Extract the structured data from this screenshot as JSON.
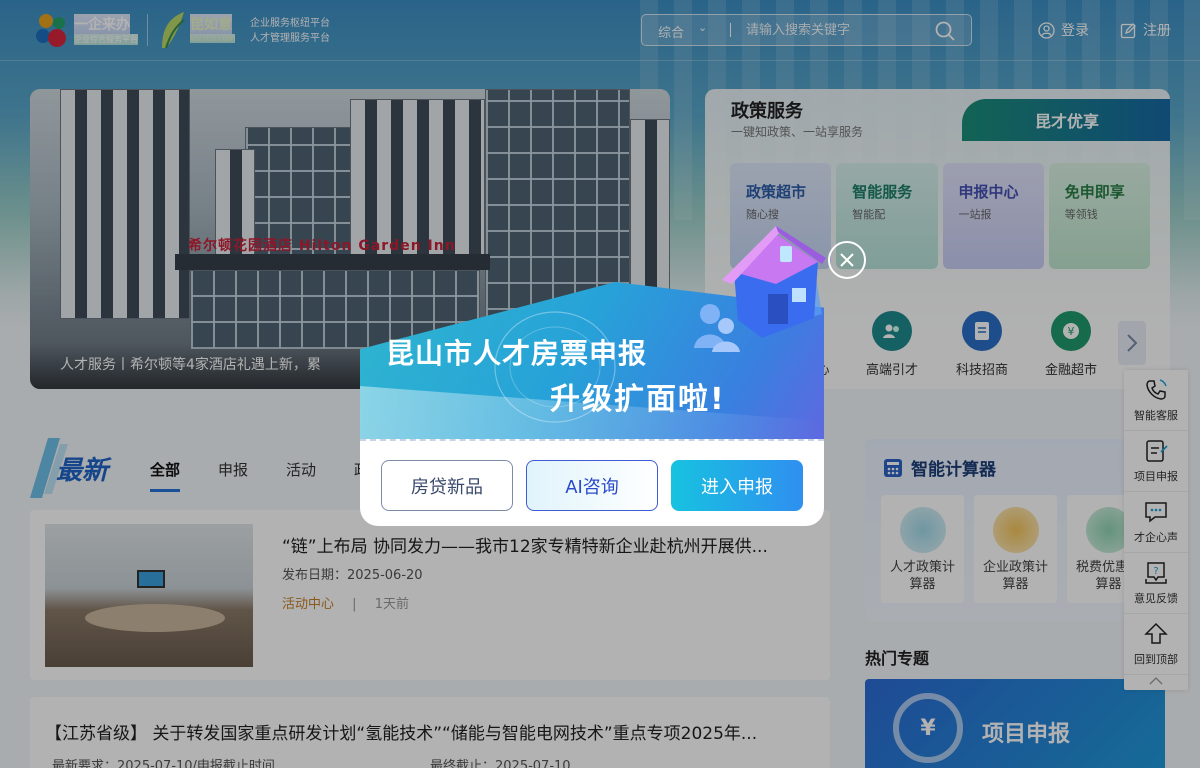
{
  "header": {
    "logo1_title": "一企来办",
    "logo1_sub": "企业综合服务平台",
    "logo2_title": "昆如意",
    "logo2_sub": "ksrstis.com",
    "platform_line1": "企业服务枢纽平台",
    "platform_line2": "人才管理服务平台",
    "search_scope": "综合",
    "search_placeholder": "请输入搜索关键字",
    "login": "登录",
    "register": "注册"
  },
  "banner": {
    "signage": "希尔顿花园酒店 Hilton Garden Inn",
    "caption": "人才服务丨希尔顿等4家酒店礼遇上新，累"
  },
  "policy": {
    "title": "政策服务",
    "subtitle": "一键知政策、一站享服务",
    "right_tab": "昆才优享",
    "tiles": [
      {
        "title": "政策超市",
        "sub": "随心搜"
      },
      {
        "title": "智能服务",
        "sub": "智能配"
      },
      {
        "title": "申报中心",
        "sub": "一站报"
      },
      {
        "title": "免申即享",
        "sub": "等领钱"
      }
    ],
    "quick": [
      {
        "label": "心"
      },
      {
        "label": "高端引才"
      },
      {
        "label": "科技招商"
      },
      {
        "label": "金融超市"
      }
    ]
  },
  "news": {
    "logo": "最新",
    "tabs": [
      "全部",
      "申报",
      "活动",
      "政"
    ],
    "item1": {
      "title": "“链”上布局 协同发力——我市12家专精特新企业赴杭州开展供...",
      "date": "发布日期：2025-06-20",
      "category": "活动中心",
      "sep": "|",
      "ago": "1天前"
    },
    "item2": {
      "title": "【江苏省级】 关于转发国家重点研发计划“氢能技术”“储能与智能电网技术”重点专项2025年...",
      "meta1": "最新要求：2025-07-10/申报截止时间",
      "meta2": "最终截止：2025-07-10"
    }
  },
  "calculator": {
    "title": "智能计算器",
    "cards": [
      {
        "label": "人才政策计算器"
      },
      {
        "label": "企业政策计算器"
      },
      {
        "label": "税费优惠计算器"
      }
    ]
  },
  "hot": {
    "title": "热门专题",
    "banner_icon": "¥",
    "banner_label": "项目申报"
  },
  "sidebar": {
    "items": [
      {
        "label": "智能客服",
        "icon": "phone-icon"
      },
      {
        "label": "项目申报",
        "icon": "form-icon"
      },
      {
        "label": "才企心声",
        "icon": "chat-icon"
      },
      {
        "label": "意见反馈",
        "icon": "feedback-icon"
      },
      {
        "label": "回到顶部",
        "icon": "back-top-icon"
      }
    ]
  },
  "modal": {
    "headline1": "昆山市人才房票申报",
    "headline2": "升级扩面啦!",
    "buttons": [
      "房贷新品",
      "AI咨询",
      "进入申报"
    ]
  },
  "colors": {
    "accent": "#2673d9",
    "modal_primary": "#17c2e0",
    "mask": "rgba(0,0,0,0.3)"
  }
}
